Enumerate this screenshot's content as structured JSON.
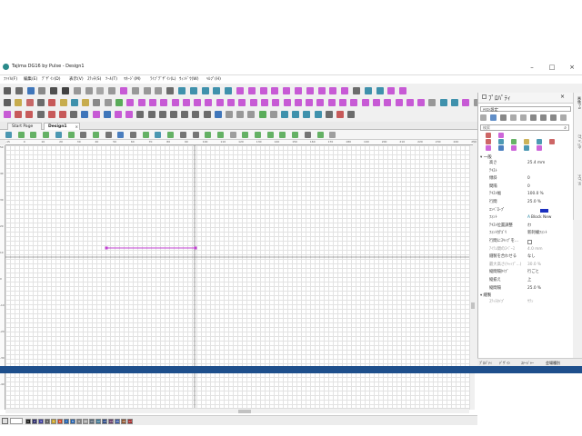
{
  "window": {
    "title": "Tajima DG16 by Pulse - Design1",
    "controls": [
      "–",
      "□",
      "×"
    ]
  },
  "menu": {
    "items": [
      "ﾌｧｲﾙ(F)",
      "編集(E)",
      "ﾃﾞｻﾞｲﾝ(D)",
      "表示(V)",
      "ｽﾃｯﾁ(S)",
      "ﾂｰﾙ(T)",
      "ﾏﾈｰｼﾞ(M)",
      "ﾗｲﾌﾞﾃﾞｻﾞｲﾝ(L)",
      "ｳｨﾝﾄﾞｳ(W)",
      "ﾍﾙﾌﾟ(H)"
    ]
  },
  "tabs": [
    {
      "label": "Start Page",
      "active": false
    },
    {
      "label": "Design1",
      "active": true
    }
  ],
  "rulers": {
    "top_ticks": [
      "-15",
      "0",
      "10",
      "20",
      "30",
      "40",
      "50",
      "60",
      "70",
      "80",
      "90",
      "100",
      "110",
      "120",
      "130",
      "140",
      "150",
      "160",
      "170",
      "180",
      "190",
      "200",
      "210",
      "220",
      "230",
      "240",
      "250"
    ],
    "left_ticks": [
      "50",
      "40",
      "30",
      "20",
      "10",
      "0",
      "-10",
      "-20",
      "-30",
      "-40"
    ]
  },
  "status": {
    "zoom_value": "",
    "swatches": [
      {
        "label": "1",
        "color": "#1a1a1a"
      },
      {
        "label": "2",
        "color": "#2a2a6a"
      },
      {
        "label": "3",
        "color": "#3a3aa0"
      },
      {
        "label": "4",
        "color": "#5a5a5a"
      },
      {
        "label": "5",
        "color": "#c8a020"
      },
      {
        "label": "6",
        "color": "#d04020"
      },
      {
        "label": "7",
        "color": "#2060b0"
      },
      {
        "label": "8",
        "color": "#2060b0"
      },
      {
        "label": "9",
        "color": "#808080"
      },
      {
        "label": "10",
        "color": "#a0a0a0"
      },
      {
        "label": "11",
        "color": "#506070"
      },
      {
        "label": "12",
        "color": "#307090"
      },
      {
        "label": "13",
        "color": "#204080"
      },
      {
        "label": "14",
        "color": "#603060"
      },
      {
        "label": "15",
        "color": "#3050a0"
      },
      {
        "label": "16",
        "color": "#8a4a20"
      },
      {
        "label": "17",
        "color": "#a02020"
      }
    ]
  },
  "properties": {
    "title": "ﾌﾟﾛﾊﾟﾃｨ",
    "object_type": "ﾃｷｽﾄ設定",
    "search_placeholder": "検索",
    "section_general": "一般",
    "section_stitch": "縫製",
    "rows": [
      {
        "key": "高さ",
        "value": "25.4 mm",
        "dim": false
      },
      {
        "key": "ﾃｷｽﾄ",
        "value": "",
        "dim": false
      },
      {
        "key": "傾斜",
        "value": "0",
        "dim": false
      },
      {
        "key": "間隔",
        "value": "0",
        "dim": false
      },
      {
        "key": "ﾃｷｽﾄ幅",
        "value": "100.0 %",
        "dim": false
      },
      {
        "key": "行間",
        "value": "25.0 %",
        "dim": false
      },
      {
        "key": "ｴﾝﾍﾞﾛｰﾌﾟ",
        "value": "",
        "dim": false
      },
      {
        "key": "ﾌｫﾝﾄ",
        "value": "Block New",
        "dim": false
      },
      {
        "key": "ﾃｷｽﾄ位置調整",
        "value": "ｵﾌ",
        "dim": false
      },
      {
        "key": "ﾌｫﾝﾄｶﾃｺﾞﾘ",
        "value": "新刺繍ﾌｫﾝﾄ",
        "dim": false
      },
      {
        "key": "行間にｽｷｯﾌﾟを...",
        "value": "",
        "dim": false
      },
      {
        "key": "ｱｲﾃﾑ間のｽﾍﾟｰｽ",
        "value": "4.0 mm",
        "dim": true
      },
      {
        "key": "縫製を合わせる",
        "value": "なし",
        "dim": false
      },
      {
        "key": "最大高さ(ｷｬｯﾌﾟ...)",
        "value": "30.0 %",
        "dim": true
      },
      {
        "key": "縦間隔ﾀｲﾌﾟ",
        "value": "行ごと",
        "dim": false
      },
      {
        "key": "縦揃え",
        "value": "上",
        "dim": false
      },
      {
        "key": "縦間隔",
        "value": "25.0 %",
        "dim": false
      }
    ],
    "stitch_row": {
      "key": "ｽﾃｯﾁﾀｲﾌﾟ",
      "value": "ｻﾃﾝ"
    },
    "envelope_color": "#1a2fbf",
    "bottom_tabs": [
      "ﾌﾟﾛﾊﾟﾃｨ",
      "ﾃﾞｻﾞｲﾝ",
      "ｽﾃｰｼﾞｬｰ",
      "会場種別"
    ]
  },
  "side_tabs": [
    "画像ﾂｰﾙ",
    "ｵﾌﾞｼﾞｪｸﾄ",
    "ﾗｲﾌﾞﾗﾘ"
  ],
  "colors": {
    "accent_purple": "#b03cc0",
    "status_blue": "#1e4f8c",
    "selected_line": "#c040d0"
  }
}
